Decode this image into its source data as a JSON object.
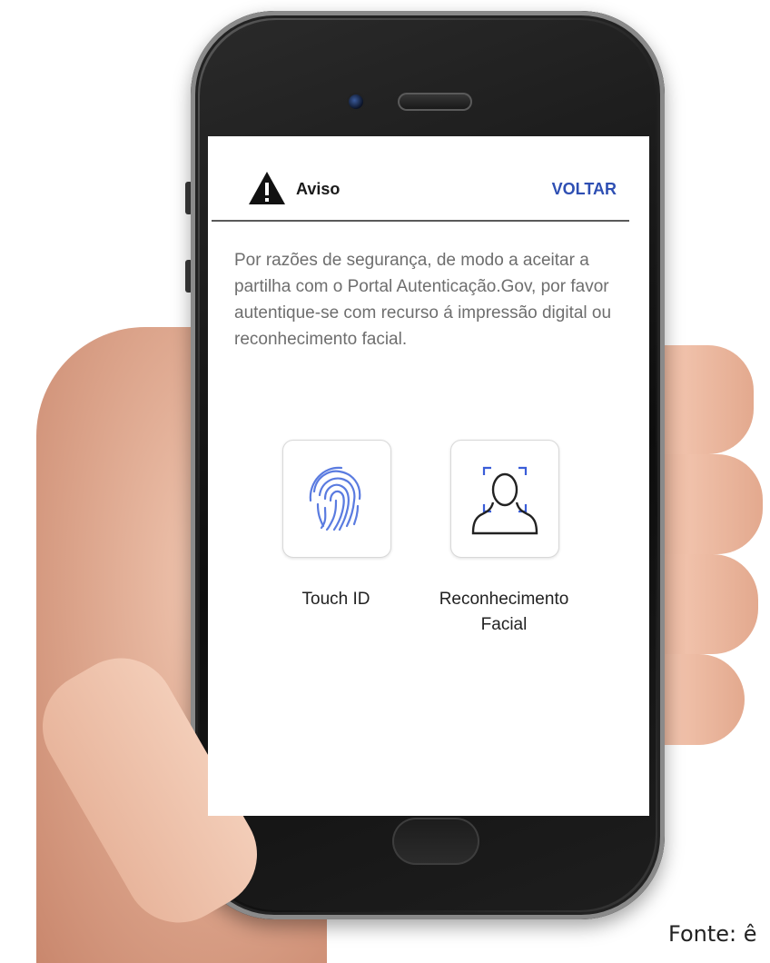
{
  "header": {
    "title": "Aviso",
    "back_label": "VOLTAR"
  },
  "message": "Por razões de segurança, de modo a aceitar a partilha com o Portal Autenticação.Gov, por favor autentique-se com recurso á impressão digital ou reconhecimento facial.",
  "options": [
    {
      "label": "Touch ID",
      "icon": "fingerprint-icon"
    },
    {
      "label": "Reconhecimento Facial",
      "icon": "face-recognition-icon"
    }
  ],
  "caption": "Fonte: ê",
  "colors": {
    "accent": "#2e4fb3",
    "text": "#6e6e6e",
    "fingerprint": "#5a7be0"
  }
}
